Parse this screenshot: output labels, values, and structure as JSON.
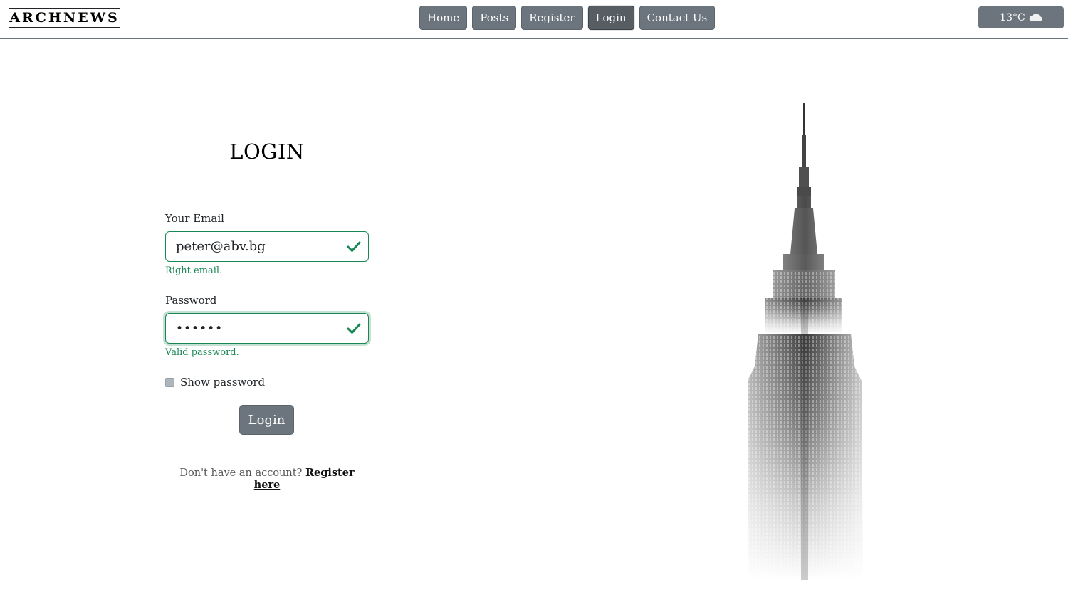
{
  "header": {
    "logo": "ARCHNEWS",
    "nav": [
      "Home",
      "Posts",
      "Register",
      "Login",
      "Contact Us"
    ],
    "active_nav": "Login",
    "weather": {
      "temp": "13°C",
      "icon": "cloud-icon"
    }
  },
  "form": {
    "title": "LOGIN",
    "email_label": "Your Email",
    "email_value": "peter@abv.bg",
    "email_feedback": "Right email.",
    "password_label": "Password",
    "password_value": "••••••",
    "password_feedback": "Valid password.",
    "show_password_label": "Show password",
    "login_button": "Login",
    "no_account_text": "Don't have an account?",
    "register_link": "Register here"
  },
  "colors": {
    "valid": "#198754",
    "button": "#6c757d"
  },
  "image": {
    "subject": "skyscraper-illustration"
  }
}
